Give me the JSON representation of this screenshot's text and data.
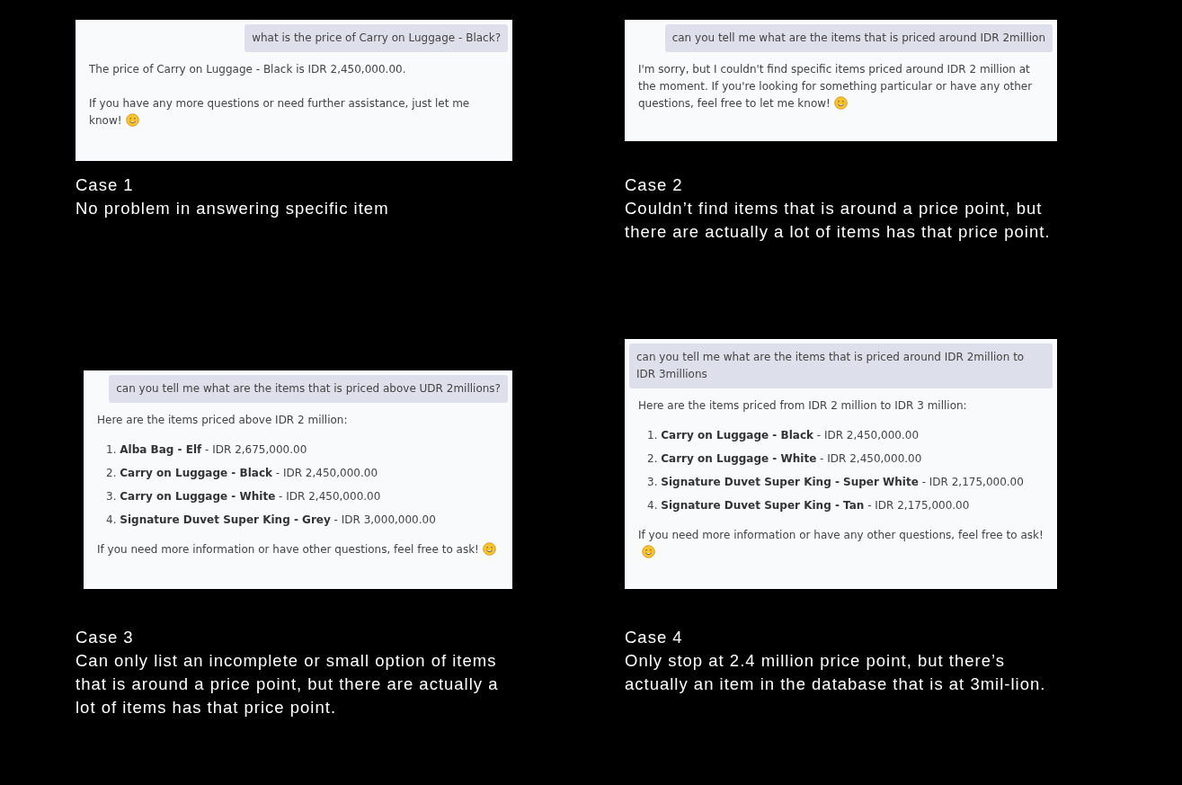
{
  "rows": [
    {
      "cases": [
        {
          "label": "Case 1",
          "description": "No problem in answering specific item",
          "chat": {
            "user_message": "what is the price of Carry on Luggage - Black?",
            "reply": [
              {
                "kind": "paragraph",
                "text": "The price of Carry on Luggage - Black is IDR 2,450,000.00.",
                "emoji": false
              },
              {
                "kind": "paragraph",
                "text": "If you have any more questions or need further assistance, just let me know!",
                "emoji": true
              }
            ]
          }
        },
        {
          "label": "Case 2",
          "description": "Couldn’t find items that is around a price point, but there are actually a lot of items has that price point.",
          "chat": {
            "user_message": "can you tell me what are the items that is priced around IDR 2million",
            "reply": [
              {
                "kind": "paragraph",
                "text": "I'm sorry, but I couldn't find specific items priced around IDR 2 million at the moment. If you're looking for something particular or have any other questions, feel free to let me know!",
                "emoji": true
              }
            ]
          }
        }
      ]
    },
    {
      "cases": [
        {
          "label": "Case 3",
          "description": "Can only list an incomplete or small option of items that is around a price point, but there are actually a lot of items has that price point.",
          "chat": {
            "user_message": "can you tell me what are the items that is priced above UDR 2millions?",
            "reply": [
              {
                "kind": "paragraph",
                "text": "Here are the items priced above IDR 2 million:",
                "emoji": false
              },
              {
                "kind": "list",
                "items": [
                  {
                    "number": "1.",
                    "name": "Alba Bag - Elf",
                    "price": " - IDR 2,675,000.00"
                  },
                  {
                    "number": "2.",
                    "name": "Carry on Luggage - Black",
                    "price": " - IDR 2,450,000.00"
                  },
                  {
                    "number": "3.",
                    "name": "Carry on Luggage - White",
                    "price": " - IDR 2,450,000.00"
                  },
                  {
                    "number": "4.",
                    "name": "Signature Duvet Super King - Grey",
                    "price": " - IDR 3,000,000.00"
                  }
                ]
              },
              {
                "kind": "paragraph",
                "text": "If you need more information or have other questions, feel free to ask!",
                "emoji": true
              }
            ]
          }
        },
        {
          "label": "Case 4",
          "description": "Only stop at 2.4 million price point, but there’s actually an item in the database that is at 3mil-lion.",
          "chat": {
            "user_message": "can you tell me what are the items that is priced around IDR 2million to IDR 3millions",
            "reply": [
              {
                "kind": "paragraph",
                "text": "Here are the items priced from IDR 2 million to IDR 3 million:",
                "emoji": false
              },
              {
                "kind": "list",
                "items": [
                  {
                    "number": "1.",
                    "name": "Carry on Luggage - Black",
                    "price": " - IDR 2,450,000.00"
                  },
                  {
                    "number": "2.",
                    "name": "Carry on Luggage - White",
                    "price": " - IDR 2,450,000.00"
                  },
                  {
                    "number": "3.",
                    "name": "Signature Duvet Super King - Super White",
                    "price": " - IDR 2,175,000.00"
                  },
                  {
                    "number": "4.",
                    "name": "Signature Duvet Super King - Tan",
                    "price": " - IDR 2,175,000.00"
                  }
                ]
              },
              {
                "kind": "paragraph",
                "text": "If you need more information or have any other questions, feel free to ask!",
                "emoji": true
              }
            ]
          }
        }
      ]
    }
  ]
}
